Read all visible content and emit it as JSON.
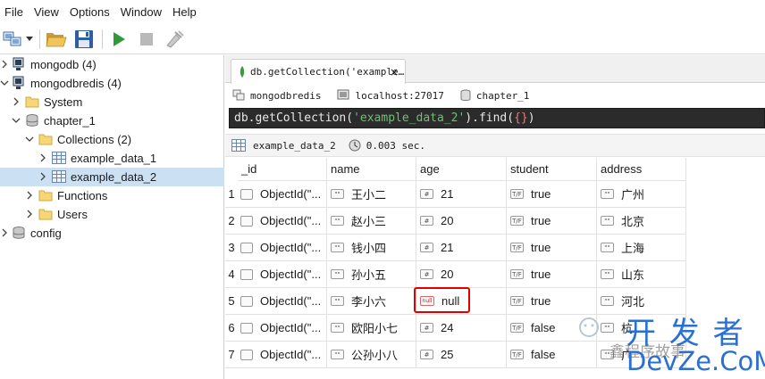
{
  "menubar": {
    "items": [
      "File",
      "View",
      "Options",
      "Window",
      "Help"
    ]
  },
  "toolbar": {
    "buttons": [
      "connect-icon",
      "dropdown-icon",
      "open-folder-icon",
      "save-icon",
      "run-icon",
      "stop-icon",
      "format-icon"
    ]
  },
  "sidebar": {
    "items": [
      {
        "label": "mongodb (4)",
        "icon": "server-icon",
        "level": 0,
        "expanded": false
      },
      {
        "label": "mongodbredis (4)",
        "icon": "server-icon",
        "level": 0,
        "expanded": true
      },
      {
        "label": "System",
        "icon": "folder-icon",
        "level": 1,
        "expanded": false
      },
      {
        "label": "chapter_1",
        "icon": "database-icon",
        "level": 1,
        "expanded": true
      },
      {
        "label": "Collections (2)",
        "icon": "folder-icon",
        "level": 2,
        "expanded": true
      },
      {
        "label": "example_data_1",
        "icon": "collection-icon",
        "level": 3,
        "expanded": false
      },
      {
        "label": "example_data_2",
        "icon": "collection-icon",
        "level": 3,
        "expanded": false,
        "selected": true
      },
      {
        "label": "Functions",
        "icon": "folder-icon",
        "level": 2,
        "expanded": false
      },
      {
        "label": "Users",
        "icon": "folder-icon",
        "level": 2,
        "expanded": false
      },
      {
        "label": "config",
        "icon": "database-icon",
        "level": 0,
        "expanded": false
      }
    ]
  },
  "tab": {
    "label": "db.getCollection('example…",
    "close": "×"
  },
  "connection": {
    "server": "mongodbredis",
    "host": "localhost:27017",
    "database": "chapter_1"
  },
  "query": {
    "prefix": "db.getCollection(",
    "arg": "'example_data_2'",
    "middle": ").find(",
    "obj": "{}",
    "suffix": ")"
  },
  "result": {
    "collection": "example_data_2",
    "time": "0.003 sec."
  },
  "table": {
    "headers": [
      "_id",
      "name",
      "age",
      "student",
      "address"
    ],
    "rows": [
      {
        "num": "1",
        "id": "ObjectId(\"...",
        "name": "王小二",
        "age": "21",
        "student": "true",
        "address": "广州"
      },
      {
        "num": "2",
        "id": "ObjectId(\"...",
        "name": "赵小三",
        "age": "20",
        "student": "true",
        "address": "北京"
      },
      {
        "num": "3",
        "id": "ObjectId(\"...",
        "name": "钱小四",
        "age": "21",
        "student": "true",
        "address": "上海"
      },
      {
        "num": "4",
        "id": "ObjectId(\"...",
        "name": "孙小五",
        "age": "20",
        "student": "true",
        "address": "山东"
      },
      {
        "num": "5",
        "id": "ObjectId(\"...",
        "name": "李小六",
        "age": "null",
        "student": "true",
        "address": "河北",
        "age_type": "null"
      },
      {
        "num": "6",
        "id": "ObjectId(\"...",
        "name": "欧阳小七",
        "age": "24",
        "student": "false",
        "address": "杭"
      },
      {
        "num": "7",
        "id": "ObjectId(\"...",
        "name": "公孙小八",
        "age": "25",
        "student": "false",
        "address": "广"
      }
    ]
  },
  "type_badges": {
    "string": "\"\"",
    "number": "#",
    "bool": "T/F",
    "null": "null"
  },
  "watermark": {
    "line1": "开 发 者",
    "line2": "DevZe.CoM",
    "sub": "鑫程序故事"
  },
  "colors": {
    "highlight": "#e00000",
    "selected_row": "#cce0f4",
    "query_bg": "#2b2b2b",
    "watermark": "#2a6fd6"
  }
}
